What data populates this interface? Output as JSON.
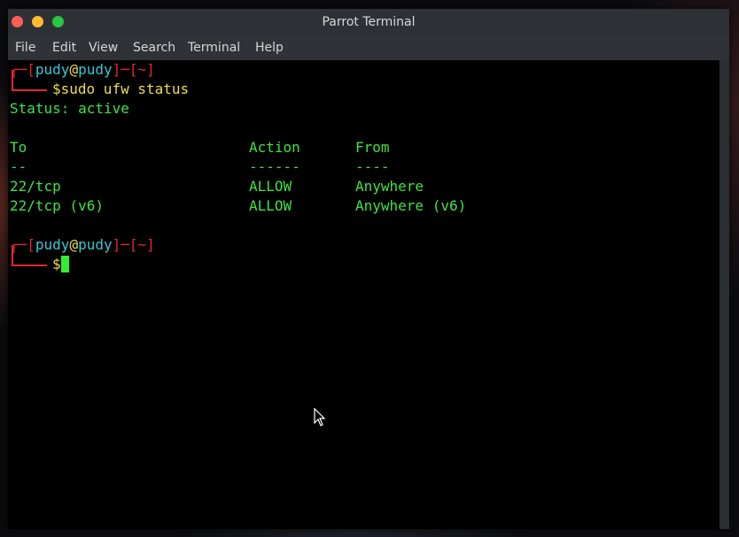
{
  "window": {
    "title": "Parrot Terminal"
  },
  "menu": [
    "File",
    "Edit",
    "View",
    "Search",
    "Terminal",
    "Help"
  ],
  "prompt": {
    "user": "pudy",
    "at": "@",
    "host": "pudy",
    "dir": "~",
    "dollar": "$"
  },
  "command": "sudo ufw status",
  "output": {
    "status": "Status: active",
    "headers": [
      "To",
      "Action",
      "From"
    ],
    "dividers": [
      "--",
      "------",
      "----"
    ],
    "rows": [
      [
        "22/tcp",
        "ALLOW",
        "Anywhere"
      ],
      [
        "22/tcp (v6)",
        "ALLOW",
        "Anywhere (v6)"
      ]
    ]
  },
  "colors": {
    "prompt_frame": "#e4272a",
    "user_host": "#39c6d8",
    "dollar": "#f0dc4a",
    "output_text": "#3fe33f"
  }
}
